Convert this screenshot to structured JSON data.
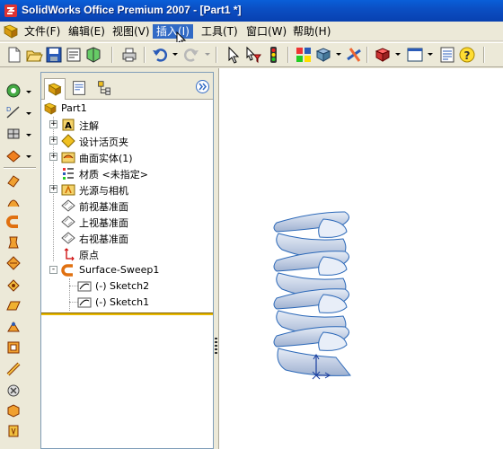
{
  "window": {
    "title": "SolidWorks Office Premium 2007 - [Part1 *]"
  },
  "menu": {
    "items": [
      {
        "label": "文件(F)"
      },
      {
        "label": "编辑(E)"
      },
      {
        "label": "视图(V)"
      },
      {
        "label": "插入(I)",
        "active": true
      },
      {
        "label": "工具(T)"
      },
      {
        "label": "窗口(W)"
      },
      {
        "label": "帮助(H)"
      }
    ]
  },
  "toolbar": {
    "icons": [
      "new-document-icon",
      "open-folder-icon",
      "save-icon",
      "print-preview-icon",
      "rebuild-icon",
      "print-icon",
      "undo-icon",
      "redo-icon",
      "select-icon",
      "select-filter-icon",
      "traffic-light-icon",
      "options-grid-icon",
      "view-orientation-icon",
      "relations-icon",
      "appearance-icon",
      "window-icon",
      "properties-icon",
      "help-icon"
    ]
  },
  "feature_manager": {
    "tabs": [
      "featuremanager-tab",
      "propertymanager-tab",
      "configurationmanager-tab"
    ],
    "tree": [
      {
        "label": "Part1",
        "icon": "part-icon",
        "expander": ""
      },
      {
        "label": "注解",
        "icon": "annotations-icon",
        "expander": "+"
      },
      {
        "label": "设计活页夹",
        "icon": "design-binder-icon",
        "expander": "+"
      },
      {
        "label": "曲面实体(1)",
        "icon": "surface-bodies-icon",
        "expander": "+"
      },
      {
        "label": "材质 <未指定>",
        "icon": "material-icon",
        "expander": ""
      },
      {
        "label": "光源与相机",
        "icon": "lights-cameras-icon",
        "expander": "+"
      },
      {
        "label": "前视基准面",
        "icon": "plane-icon",
        "expander": ""
      },
      {
        "label": "上视基准面",
        "icon": "plane-icon",
        "expander": ""
      },
      {
        "label": "右视基准面",
        "icon": "plane-icon",
        "expander": ""
      },
      {
        "label": "原点",
        "icon": "origin-icon",
        "expander": ""
      },
      {
        "label": "Surface-Sweep1",
        "icon": "surface-sweep-icon",
        "expander": "-"
      },
      {
        "label": "(-) Sketch2",
        "icon": "sketch-icon",
        "expander": ""
      },
      {
        "label": "(-) Sketch1",
        "icon": "sketch-icon",
        "expander": ""
      }
    ]
  },
  "colors": {
    "title_bar": "#0b4fc4",
    "menu_highlight": "#316ac5",
    "rollback_bar": "#e8b800",
    "model_fill": "#c8d3e6",
    "model_edge": "#2b68b8"
  }
}
